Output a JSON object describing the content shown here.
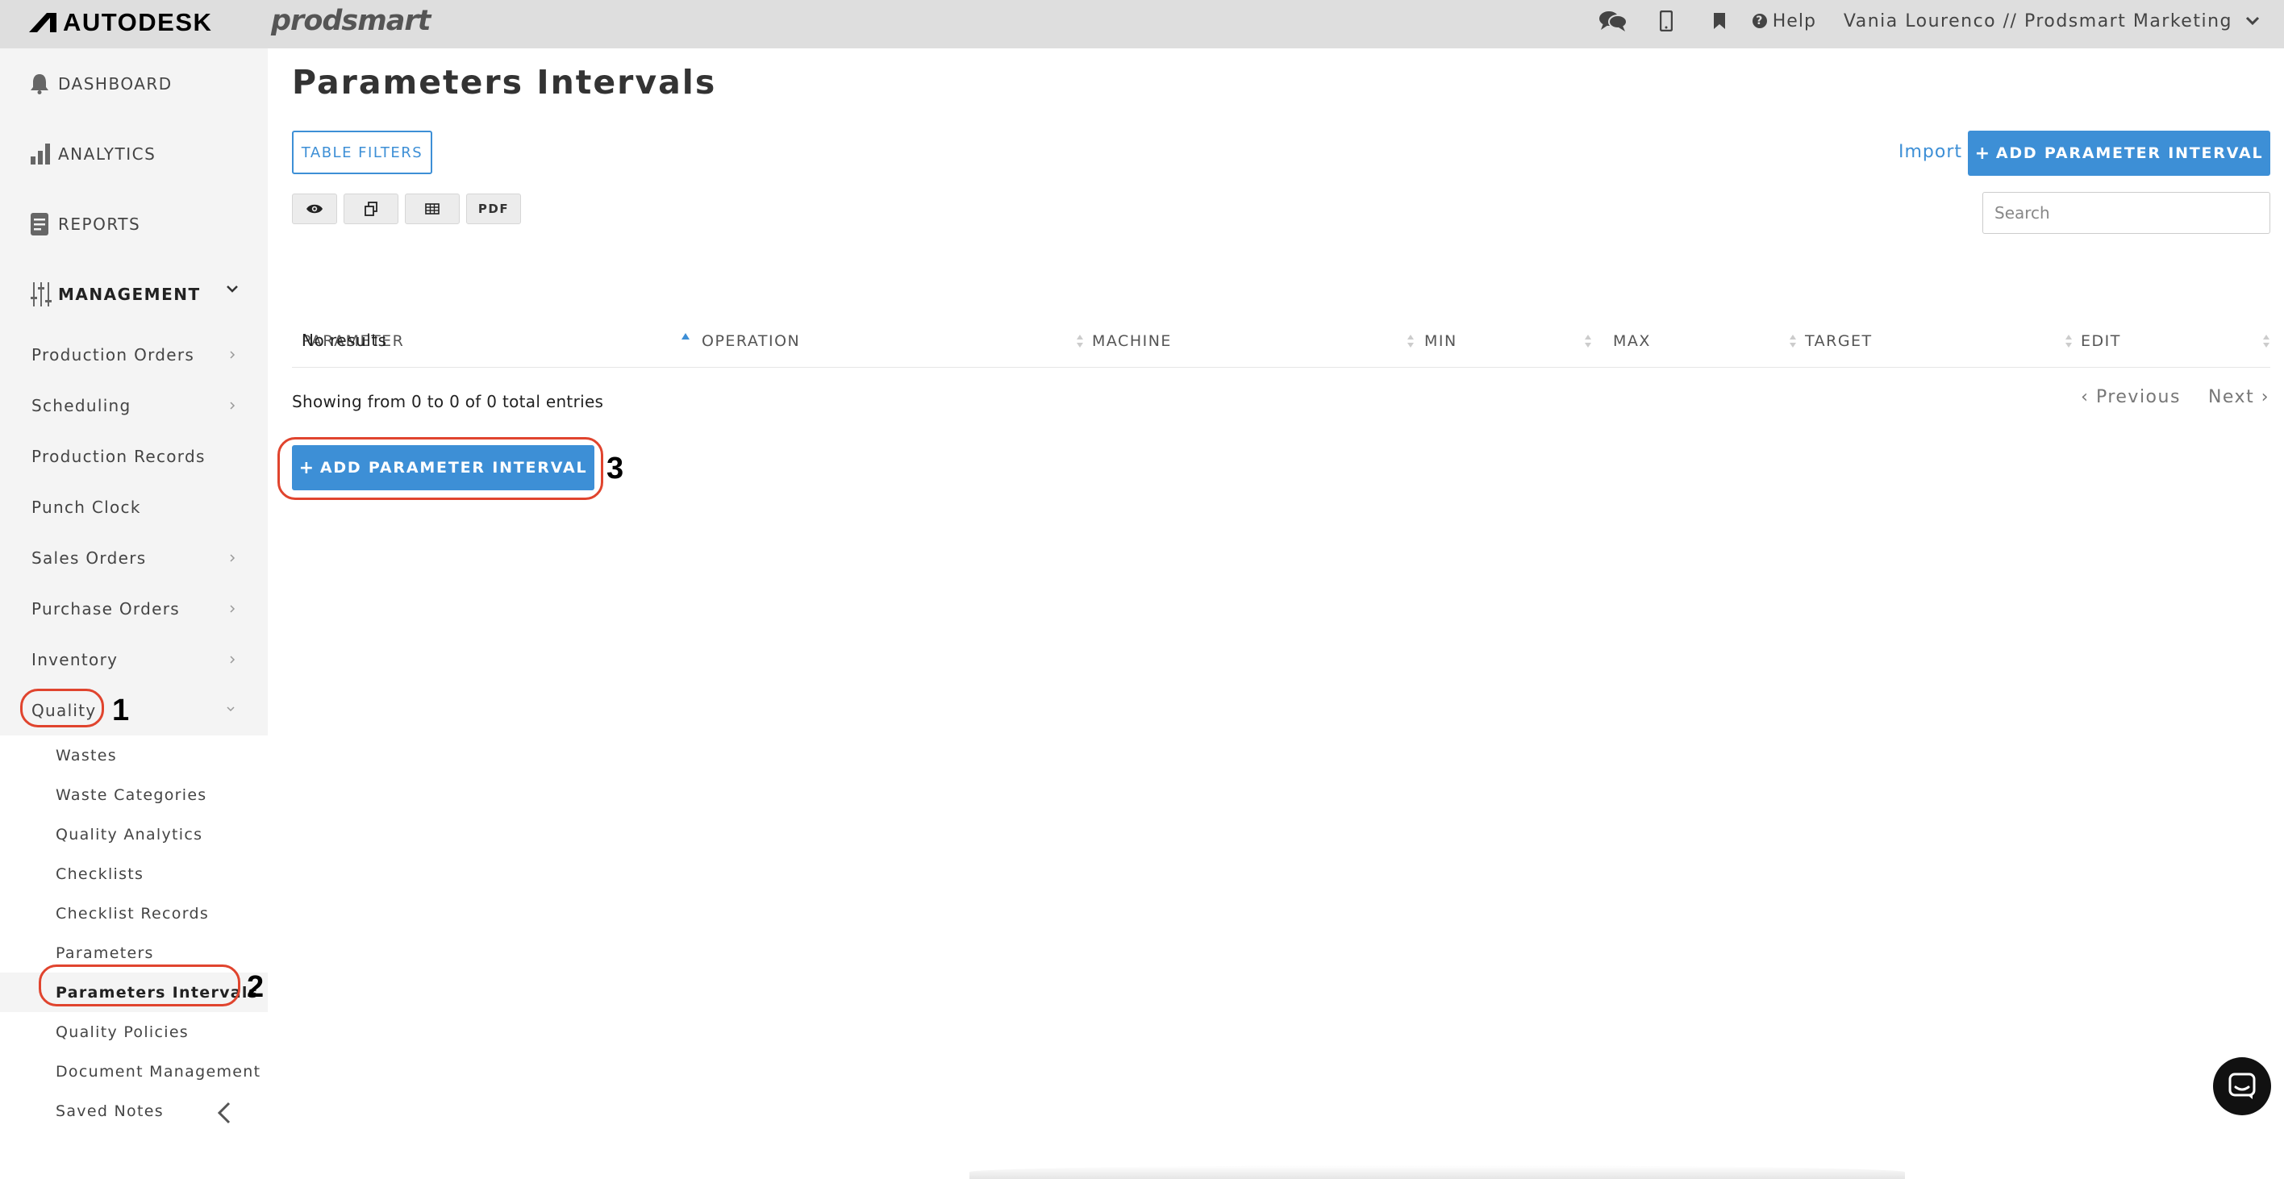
{
  "topbar": {
    "brand": "AUTODESK",
    "product": "prodsmart",
    "help_label": "Help",
    "user_label": "Vania Lourenco // Prodsmart Marketing",
    "icons": [
      "chat-icon",
      "mobile-icon",
      "bookmark-icon",
      "help-icon",
      "chevron-down-icon"
    ]
  },
  "sidebar": {
    "main_items": [
      {
        "label": "DASHBOARD",
        "icon": "bell-icon"
      },
      {
        "label": "ANALYTICS",
        "icon": "bar-chart-icon"
      },
      {
        "label": "REPORTS",
        "icon": "document-icon"
      },
      {
        "label": "MANAGEMENT",
        "icon": "sliders-icon"
      }
    ],
    "management_items": [
      {
        "label": "Production Orders",
        "has_caret": true
      },
      {
        "label": "Scheduling",
        "has_caret": true
      },
      {
        "label": "Production Records",
        "has_caret": false
      },
      {
        "label": "Punch Clock",
        "has_caret": false
      },
      {
        "label": "Sales Orders",
        "has_caret": true
      },
      {
        "label": "Purchase Orders",
        "has_caret": true
      },
      {
        "label": "Inventory",
        "has_caret": true
      },
      {
        "label": "Quality",
        "has_caret": true
      }
    ],
    "quality_items": [
      {
        "label": "Wastes"
      },
      {
        "label": "Waste Categories"
      },
      {
        "label": "Quality Analytics"
      },
      {
        "label": "Checklists"
      },
      {
        "label": "Checklist Records"
      },
      {
        "label": "Parameters"
      },
      {
        "label": "Parameters Intervals",
        "active": true
      },
      {
        "label": "Quality Policies"
      },
      {
        "label": "Document Management"
      },
      {
        "label": "Saved Notes"
      }
    ]
  },
  "main": {
    "title": "Parameters Intervals",
    "table_filters_label": "TABLE FILTERS",
    "tool_buttons": [
      {
        "icon": "eye-icon",
        "label": ""
      },
      {
        "icon": "copy-icon",
        "label": ""
      },
      {
        "icon": "table-icon",
        "label": ""
      },
      {
        "icon": "",
        "label": "PDF"
      }
    ],
    "import_label": "Import",
    "add_button_label": "ADD PARAMETER INTERVAL",
    "search_placeholder": "Search",
    "columns": [
      "PARAMETER",
      "OPERATION",
      "MACHINE",
      "MIN",
      "MAX",
      "TARGET",
      "EDIT"
    ],
    "sorted_column": "PARAMETER",
    "no_results": "No results",
    "showing": "Showing from 0 to 0 of 0 total entries",
    "prev_label": "Previous",
    "next_label": "Next"
  },
  "annotations": [
    "1",
    "2",
    "3"
  ],
  "colors": {
    "accent": "#3d8fd6",
    "annotation_ring": "#e0442e",
    "topbar_bg": "#dedede",
    "sidebar_bg": "#f4f4f4"
  }
}
